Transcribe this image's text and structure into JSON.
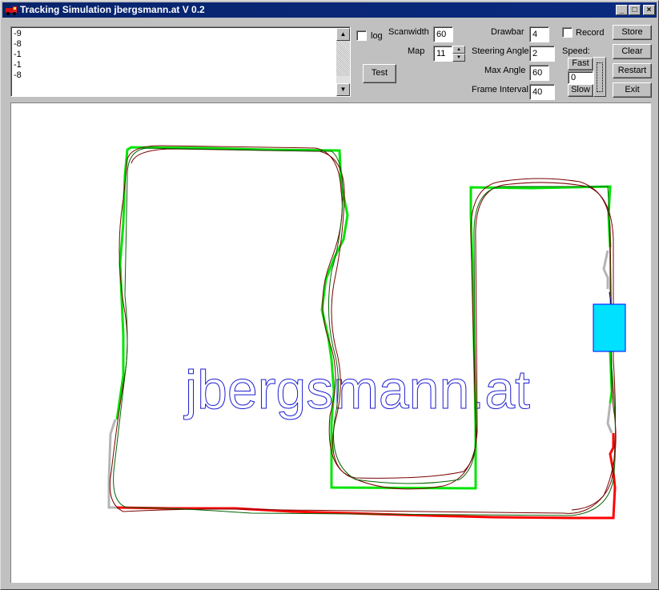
{
  "window": {
    "title": "Tracking Simulation jbergsmann.at V 0.2",
    "controls": {
      "minimize": "_",
      "maximize": "□",
      "close": "×"
    }
  },
  "log_lines": [
    "-9",
    "-8",
    "-1",
    "-1",
    "-8"
  ],
  "controls": {
    "log_label": "log",
    "scanwidth_label": "Scanwidth",
    "scanwidth_value": "60",
    "map_label": "Map",
    "map_value": "11",
    "test_button": "Test",
    "drawbar_label": "Drawbar",
    "drawbar_value": "4",
    "steering_angle_label": "Steering Angle",
    "steering_angle_value": "2",
    "max_angle_label": "Max Angle",
    "max_angle_value": "60",
    "frame_interval_label": "Frame Interval",
    "frame_interval_value": "40",
    "record_label": "Record",
    "speed_label": "Speed:",
    "fast_button": "Fast",
    "speed_value": "0",
    "slow_button": "Slow",
    "store_button": "Store",
    "clear_button": "Clear",
    "restart_button": "Restart",
    "exit_button": "Exit"
  },
  "canvas": {
    "watermark": "jbergsmann.at",
    "colors": {
      "track_green": "#00e400",
      "track_red": "#ff0000",
      "track_gray": "#b4b4b4",
      "path_darkred": "#7a0000",
      "path_darkgreen": "#006400",
      "vehicle": "#00e0ff",
      "watermark": "#1a1ad0"
    }
  }
}
